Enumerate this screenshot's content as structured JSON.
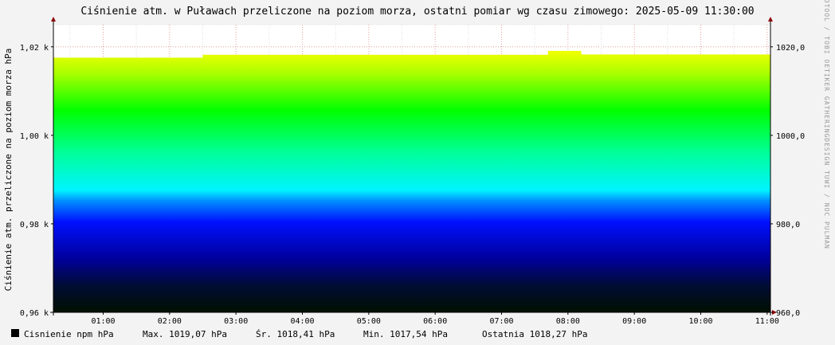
{
  "chart_data": {
    "type": "area",
    "title": "Ciśnienie atm. w Puławach przeliczone na poziom morza, ostatni pomiar wg czasu zimowego: 2025-05-09 11:30:00",
    "ylabel": "Ciśnienie atm. przeliczone na poziom morza hPa",
    "side_credit": "RRDTOOL / TOBI OETIKER   GATHERINGDESIGN TUWI / NOC PULMAN",
    "xlim": [
      0.25,
      11.05
    ],
    "ylim": [
      960,
      1025
    ],
    "x_ticks": [
      {
        "v": 1,
        "label": "01:00"
      },
      {
        "v": 2,
        "label": "02:00"
      },
      {
        "v": 3,
        "label": "03:00"
      },
      {
        "v": 4,
        "label": "04:00"
      },
      {
        "v": 5,
        "label": "05:00"
      },
      {
        "v": 6,
        "label": "06:00"
      },
      {
        "v": 7,
        "label": "07:00"
      },
      {
        "v": 8,
        "label": "08:00"
      },
      {
        "v": 9,
        "label": "09:00"
      },
      {
        "v": 10,
        "label": "10:00"
      },
      {
        "v": 11,
        "label": "11:00"
      }
    ],
    "y_ticks_left": [
      {
        "v": 960,
        "label": "0,96 k"
      },
      {
        "v": 980,
        "label": "0,98 k"
      },
      {
        "v": 1000,
        "label": "1,00 k"
      },
      {
        "v": 1020,
        "label": "1,02 k"
      }
    ],
    "y_ticks_right": [
      {
        "v": 960,
        "label": "960,0"
      },
      {
        "v": 980,
        "label": "980,0"
      },
      {
        "v": 1000,
        "label": "1000,0"
      },
      {
        "v": 1020,
        "label": "1020,0"
      }
    ],
    "grid": true,
    "series": [
      {
        "name": "Cisnienie npm hPa",
        "x": [
          0.25,
          2.5,
          2.5,
          7.7,
          7.7,
          8.2,
          8.2,
          11.05
        ],
        "y": [
          1017.54,
          1017.54,
          1018.2,
          1018.2,
          1019.07,
          1019.07,
          1018.27,
          1018.27
        ]
      }
    ],
    "legend": {
      "swatch_color": "#000000",
      "label": "Cisnienie npm hPa",
      "stats": [
        "Max. 1019,07 hPa",
        "Śr. 1018,41 hPa",
        "Min. 1017,54 hPa",
        "Ostatnia 1018,27 hPa"
      ]
    },
    "gradient_stops": [
      {
        "offset": "0%",
        "color": "#001000"
      },
      {
        "offset": "10%",
        "color": "#000c33"
      },
      {
        "offset": "20%",
        "color": "#00009a"
      },
      {
        "offset": "34%",
        "color": "#0010ff"
      },
      {
        "offset": "42%",
        "color": "#0090ff"
      },
      {
        "offset": "46%",
        "color": "#00f4ff"
      },
      {
        "offset": "60%",
        "color": "#00ff9a"
      },
      {
        "offset": "76%",
        "color": "#00ff00"
      },
      {
        "offset": "90%",
        "color": "#aaff00"
      },
      {
        "offset": "100%",
        "color": "#ffff00"
      }
    ]
  }
}
